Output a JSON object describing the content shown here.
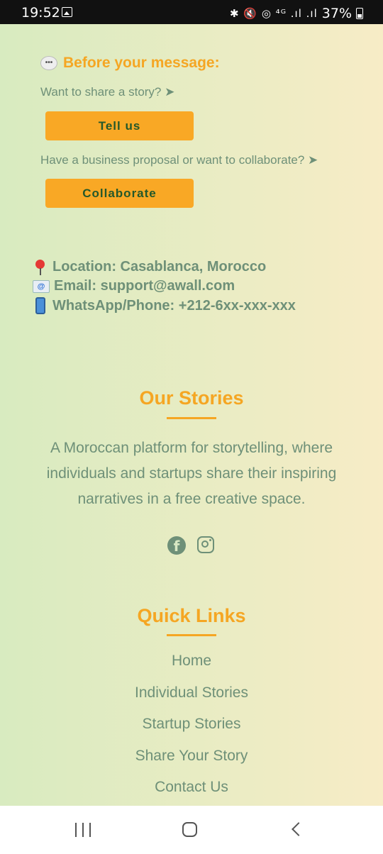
{
  "status_bar": {
    "time": "19:52",
    "icons_text": "✱ 🔇 ◎ ⁴ᴳ .ıl .ıl",
    "battery_percent": "37%"
  },
  "before": {
    "title": "Before your message:",
    "icon": "speech-bubble-icon",
    "story_prompt": "Want to share a story? ➤",
    "story_button": "Tell us",
    "business_prompt": "Have a business proposal or want to collaborate? ➤",
    "business_button": "Collaborate"
  },
  "contact": {
    "location": "Location: Casablanca, Morocco",
    "email": "Email: support@awall.com",
    "phone": "WhatsApp/Phone: +212-6xx-xxx-xxx"
  },
  "our_stories": {
    "title": "Our Stories",
    "description": "A Moroccan platform for storytelling, where individuals and startups share their inspiring narratives in a free creative space.",
    "social": [
      "facebook-icon",
      "instagram-icon"
    ]
  },
  "quick_links": {
    "title": "Quick Links",
    "items": [
      "Home",
      "Individual Stories",
      "Startup Stories",
      "Share Your Story",
      "Contact Us"
    ]
  },
  "colors": {
    "accent": "#f5a623",
    "button": "#f9a825",
    "text_muted": "#6e9078",
    "bg_left": "#d8ebc0",
    "bg_right": "#f7ecc6"
  }
}
